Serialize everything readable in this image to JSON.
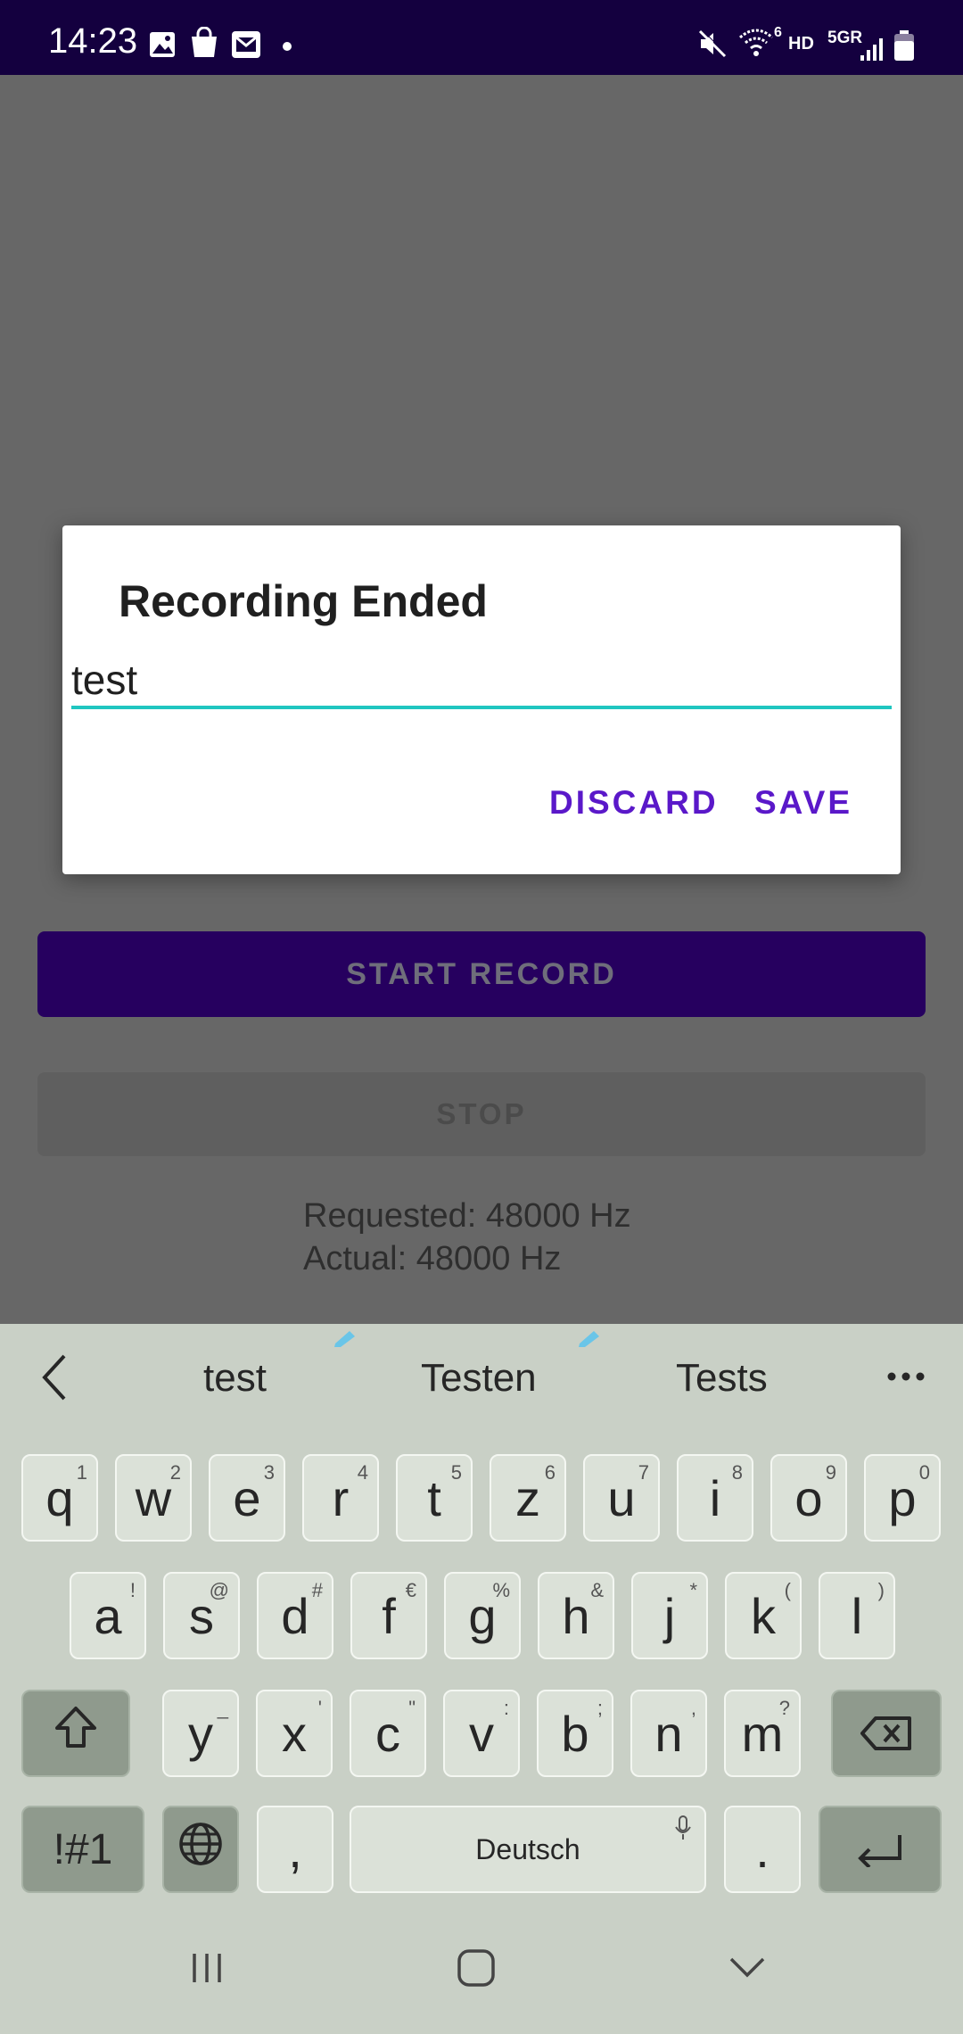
{
  "status_bar": {
    "time": "14:23",
    "left_icons": [
      "image-icon",
      "shopping-bag-icon",
      "email-icon",
      "dot-icon"
    ],
    "right_icons": [
      "mute-icon",
      "wifi-icon",
      "signal-icon",
      "battery-icon"
    ],
    "hd_label": "HD",
    "network_label": "5GR",
    "wifi_superscript": "6"
  },
  "main": {
    "start_button": "START RECORD",
    "stop_button": "STOP",
    "requested": "Requested: 48000 Hz",
    "actual": "Actual: 48000 Hz"
  },
  "dialog": {
    "title": "Recording Ended",
    "input_value": "test",
    "discard": "DISCARD",
    "save": "SAVE"
  },
  "keyboard": {
    "suggestions": [
      "test",
      "Testen",
      "Tests"
    ],
    "row1": [
      {
        "k": "q",
        "h": "1"
      },
      {
        "k": "w",
        "h": "2"
      },
      {
        "k": "e",
        "h": "3"
      },
      {
        "k": "r",
        "h": "4"
      },
      {
        "k": "t",
        "h": "5"
      },
      {
        "k": "z",
        "h": "6"
      },
      {
        "k": "u",
        "h": "7"
      },
      {
        "k": "i",
        "h": "8"
      },
      {
        "k": "o",
        "h": "9"
      },
      {
        "k": "p",
        "h": "0"
      }
    ],
    "row2": [
      {
        "k": "a",
        "h": "!"
      },
      {
        "k": "s",
        "h": "@"
      },
      {
        "k": "d",
        "h": "#"
      },
      {
        "k": "f",
        "h": "€"
      },
      {
        "k": "g",
        "h": "%"
      },
      {
        "k": "h",
        "h": "&"
      },
      {
        "k": "j",
        "h": "*"
      },
      {
        "k": "k",
        "h": "("
      },
      {
        "k": "l",
        "h": ")"
      }
    ],
    "row3": [
      {
        "k": "y",
        "h": "_"
      },
      {
        "k": "x",
        "h": "'"
      },
      {
        "k": "c",
        "h": "\""
      },
      {
        "k": "v",
        "h": ":"
      },
      {
        "k": "b",
        "h": ";"
      },
      {
        "k": "n",
        "h": ","
      },
      {
        "k": "m",
        "h": "?"
      }
    ],
    "symbols_key": "!#1",
    "comma_key": ",",
    "space_label": "Deutsch",
    "period_key": "."
  }
}
